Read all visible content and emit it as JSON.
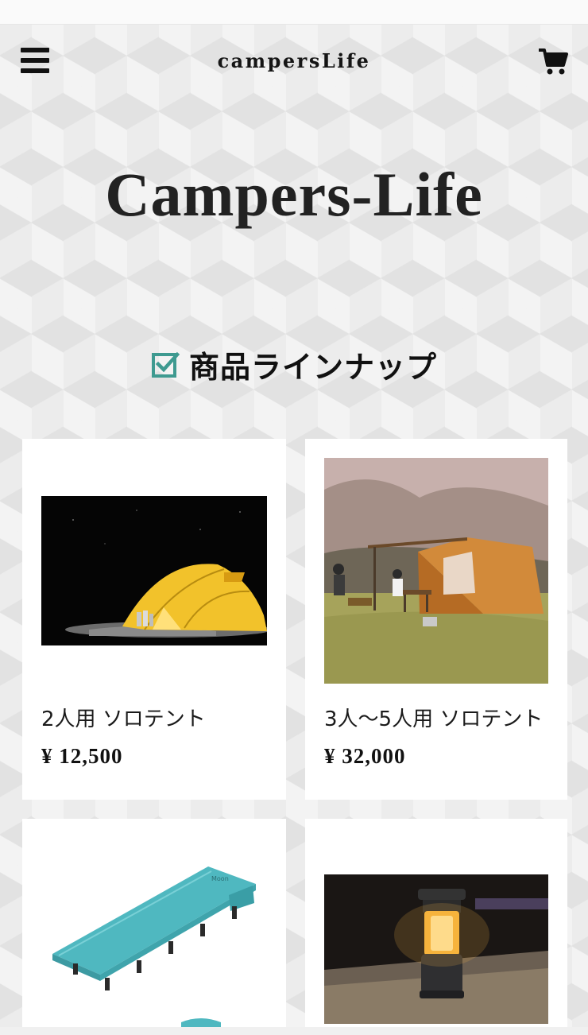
{
  "header": {
    "brand": "campersLife"
  },
  "hero": {
    "title": "Campers-Life"
  },
  "section": {
    "heading": "商品ラインナップ",
    "accent_color": "#3e9a90"
  },
  "products": [
    {
      "name": "2人用 ソロテント",
      "price": "¥ 12,500"
    },
    {
      "name": "3人〜5人用 ソロテント",
      "price": "¥ 32,000"
    },
    {
      "name": "",
      "price": ""
    },
    {
      "name": "",
      "price": ""
    }
  ],
  "icons": {
    "menu": "hamburger-icon",
    "cart": "cart-icon",
    "heading": "checkbox-check-icon"
  }
}
